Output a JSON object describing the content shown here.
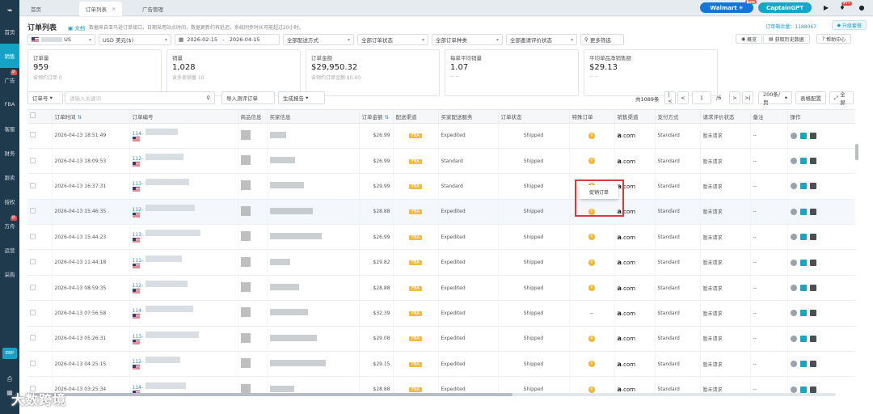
{
  "sidebar": {
    "logo": "⌁",
    "items": [
      {
        "label": "首页",
        "badge": ""
      },
      {
        "label": "销售",
        "badge": ""
      },
      {
        "label": "广告",
        "badge": "新"
      },
      {
        "label": "FBA",
        "badge": ""
      },
      {
        "label": "客服",
        "badge": ""
      },
      {
        "label": "财务",
        "badge": ""
      },
      {
        "label": "跟卖",
        "badge": ""
      },
      {
        "label": "授权",
        "badge": ""
      },
      {
        "label": "方舟",
        "badge": "新"
      },
      {
        "label": "运营",
        "badge": ""
      },
      {
        "label": "采购",
        "badge": ""
      }
    ],
    "erp": "ERP"
  },
  "topbar": {
    "tabs": [
      {
        "label": "首页",
        "closable": false
      },
      {
        "label": "订单列表",
        "closable": true
      },
      {
        "label": "广告管理",
        "closable": false
      }
    ],
    "walmart": "Walmart",
    "walmart_badge": "Beta",
    "captain": "CaptainGPT",
    "notif_badge": "99+"
  },
  "page": {
    "title": "订单列表",
    "doc_link": "文档",
    "notice": "数据来自亚马逊订单接口，日期采用站点时间，数据更新约有延迟，系统同步时长可能超过20小时。",
    "quota_label": "订单剩余量：1188067",
    "upgrade": "升级套餐"
  },
  "filters": {
    "store": "US",
    "currency": "USD 美元($)",
    "date_from": "2026-02-15",
    "date_sep": "-",
    "date_to": "2026-04-15",
    "delivery": "全部配送方式",
    "status": "全部订单状态",
    "type": "全部订单种类",
    "review": "全部邀请评价状态",
    "more": "更多筛选",
    "overview": "概览",
    "history": "获取历史数据",
    "help": "帮助中心"
  },
  "stats": [
    {
      "label": "订单量",
      "value": "959",
      "sub": "含预约订单 0"
    },
    {
      "label": "销量",
      "value": "1,028",
      "sub": "含多卖销量 10"
    },
    {
      "label": "订单金额",
      "value": "$29,950.32",
      "sub": "含预约订单金额 $0.00"
    },
    {
      "label": "每单平均销量",
      "value": "1.07",
      "sub": "-- --"
    },
    {
      "label": "平均单品净销售额",
      "value": "$29.13",
      "sub": "-- --"
    }
  ],
  "toolbar": {
    "search_type": "订单号",
    "search_placeholder": "请输入关键词",
    "import": "导入测评订单",
    "report": "生成报告",
    "total": "共1089条",
    "page": "1",
    "pages": "/6",
    "page_size": "200条/页",
    "table_config": "表格配置",
    "fullscreen": "全屏"
  },
  "columns": [
    "订单时间",
    "订单编号",
    "商品信息",
    "买家信息",
    "订单金额",
    "配送渠道",
    "买家配送服务",
    "订单状态",
    "特殊订单",
    "销售渠道",
    "支付方式",
    "请求评价状态",
    "备注",
    "操作"
  ],
  "rows": [
    {
      "time": "2026-04-13 18:51:49",
      "oid": "114-",
      "amount": "$26.99",
      "channel": "FBA",
      "service": "Expedited",
      "status": "Shipped",
      "special": "dot",
      "sales": ".com",
      "pay": "Standard",
      "review": "暂未请求",
      "note": "--"
    },
    {
      "time": "2026-04-13 18:09:53",
      "oid": "112-",
      "amount": "$26.99",
      "channel": "FBA",
      "service": "Standard",
      "status": "Shipped",
      "special": "dot",
      "sales": ".com",
      "pay": "Standard",
      "review": "暂未请求",
      "note": "--"
    },
    {
      "time": "2026-04-13 16:37:31",
      "oid": "113-",
      "amount": "$29.99",
      "channel": "FBA",
      "service": "Standard",
      "status": "Shipped",
      "special": "dot",
      "sales": ".com",
      "pay": "Standard",
      "review": "暂未请求",
      "note": "--"
    },
    {
      "time": "2026-04-13 15:46:35",
      "oid": "112-",
      "amount": "$28.88",
      "channel": "FBA",
      "service": "Expedited",
      "status": "Shipped",
      "special": "dot",
      "sales": ".com",
      "pay": "Standard",
      "review": "暂未请求",
      "note": "--"
    },
    {
      "time": "2026-04-13 15:44:23",
      "oid": "113-",
      "amount": "$26.99",
      "channel": "FBA",
      "service": "Expedited",
      "status": "Shipped",
      "special": "dot",
      "sales": ".com",
      "pay": "Standard",
      "review": "暂未请求",
      "note": "--"
    },
    {
      "time": "2026-04-13 11:44:18",
      "oid": "111-",
      "amount": "$29.82",
      "channel": "FBA",
      "service": "Expedited",
      "status": "Shipped",
      "special": "dot",
      "sales": ".com",
      "pay": "Standard",
      "review": "暂未请求",
      "note": "--"
    },
    {
      "time": "2026-04-13 08:59:35",
      "oid": "112-",
      "amount": "$28.88",
      "channel": "FBA",
      "service": "Expedited",
      "status": "Shipped",
      "special": "dot",
      "sales": ".com",
      "pay": "Standard",
      "review": "暂未请求",
      "note": "--"
    },
    {
      "time": "2026-04-13 07:56:58",
      "oid": "114-",
      "amount": "$32.39",
      "channel": "FBA",
      "service": "Expedited",
      "status": "Shipped",
      "special": "--",
      "sales": ".com",
      "pay": "Standard",
      "review": "暂未请求",
      "note": "--"
    },
    {
      "time": "2026-04-13 05:26:31",
      "oid": "113-",
      "amount": "$29.08",
      "channel": "FBA",
      "service": "Expedited",
      "status": "Shipped",
      "special": "dot",
      "sales": ".com",
      "pay": "Standard",
      "review": "暂未请求",
      "note": "--"
    },
    {
      "time": "2026-04-13 04:25:15",
      "oid": "112-",
      "amount": "$29.15",
      "channel": "FBA",
      "service": "Expedited",
      "status": "Shipped",
      "special": "dot",
      "sales": ".com",
      "pay": "Standard",
      "review": "暂未请求",
      "note": "--"
    },
    {
      "time": "2026-04-13 03:25:34",
      "oid": "114-",
      "amount": "$28.88",
      "channel": "FBA",
      "service": "Expedited",
      "status": "Shipped",
      "special": "dot",
      "sales": ".com",
      "pay": "Standard",
      "review": "暂未请求",
      "note": "--"
    }
  ],
  "tooltip": "促销订单",
  "watermark": "大数跨境",
  "colors": {
    "sidebar": "#1f3a4d",
    "accent": "#14a2c7",
    "fba": "#f5b940",
    "highlight_frame": "#d93a3a"
  }
}
